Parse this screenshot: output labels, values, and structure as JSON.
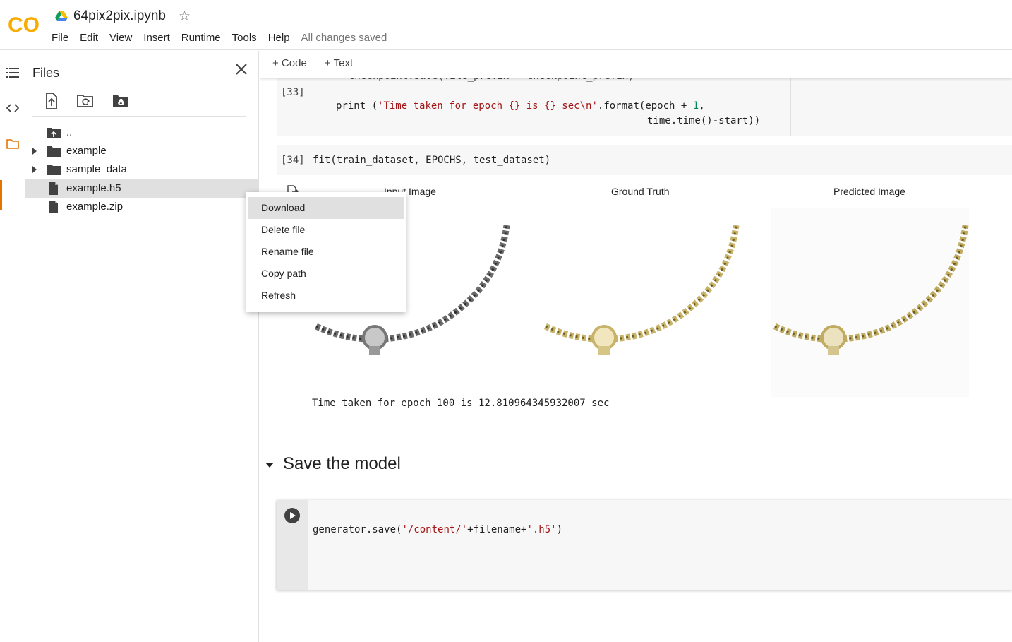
{
  "header": {
    "logo_text": "CO",
    "notebook_title": "64pix2pix.ipynb",
    "menu": [
      "File",
      "Edit",
      "View",
      "Insert",
      "Runtime",
      "Tools",
      "Help"
    ],
    "save_status": "All changes saved"
  },
  "files_panel": {
    "title": "Files",
    "tree": [
      {
        "label": "..",
        "type": "parent"
      },
      {
        "label": "example",
        "type": "folder"
      },
      {
        "label": "sample_data",
        "type": "folder"
      },
      {
        "label": "example.h5",
        "type": "file",
        "selected": true
      },
      {
        "label": "example.zip",
        "type": "file"
      }
    ]
  },
  "context_menu": [
    "Download",
    "Delete file",
    "Rename file",
    "Copy path",
    "Refresh"
  ],
  "toolbar": {
    "code_label": "+ Code",
    "text_label": "+ Text"
  },
  "cells": {
    "cell33": {
      "exec": "[33]",
      "partial_line": "checkpoint.save(file_prefix = checkpoint_prefix)",
      "line1_pre": "print (",
      "line1_str": "'Time taken for epoch {} is {} sec\\n'",
      "line1_mid": ".format(epoch + ",
      "line1_num": "1",
      "line1_post": ",",
      "line2": "time.time()-start))"
    },
    "cell34": {
      "exec": "[34]",
      "code": "fit(train_dataset, EPOCHS, test_dataset)",
      "output_titles": [
        "Input Image",
        "Ground Truth",
        "Predicted Image"
      ],
      "output_text": "Time taken for epoch 100 is 12.810964345932007 sec"
    },
    "section": {
      "heading": "Save the model"
    },
    "save_cell": {
      "code_pre": "generator.save(",
      "code_str1": "'/content/'",
      "code_mid": "+filename+",
      "code_str2": "'.h5'",
      "code_post": ")"
    }
  },
  "colors": {
    "accent": "#e37400",
    "string": "#a31515",
    "number": "#098658"
  }
}
